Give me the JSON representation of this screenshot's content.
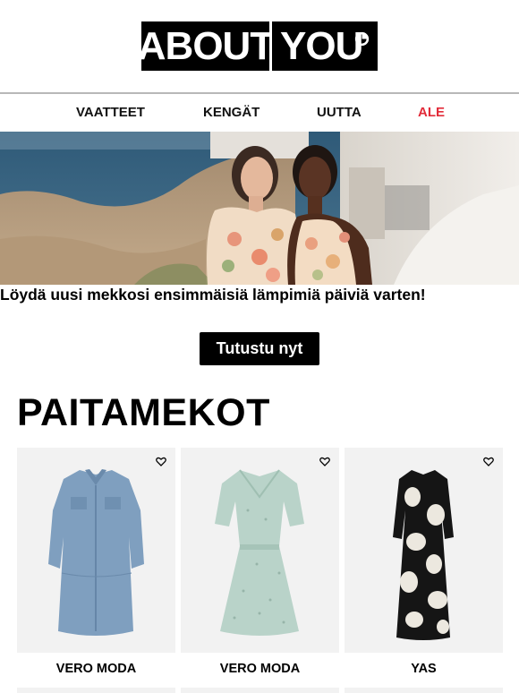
{
  "header": {
    "logo_left": "ABOUT",
    "logo_right": "YOU",
    "logo_mark": "circle-logo-mark"
  },
  "nav": {
    "items": [
      {
        "label": "VAATTEET"
      },
      {
        "label": "KENGÄT"
      },
      {
        "label": "UUTTA"
      },
      {
        "label": "ALE"
      }
    ],
    "sale_color": "#e22c3a"
  },
  "hero": {
    "image": "hero-image-two-models-floral-dresses"
  },
  "promo": {
    "tagline": "Löydä uusi mekkosi ensimmäisiä lämpimiä päiviä varten!",
    "cta_label": "Tutustu nyt"
  },
  "section": {
    "title": "PAITAMEKOT"
  },
  "products": [
    {
      "brand": "VERO MODA",
      "image": "denim-shirt-dress",
      "icon": "heart-icon"
    },
    {
      "brand": "VERO MODA",
      "image": "mint-print-dress",
      "icon": "heart-icon"
    },
    {
      "brand": "YAS",
      "image": "black-floral-maxi-dress",
      "icon": "heart-icon"
    }
  ]
}
